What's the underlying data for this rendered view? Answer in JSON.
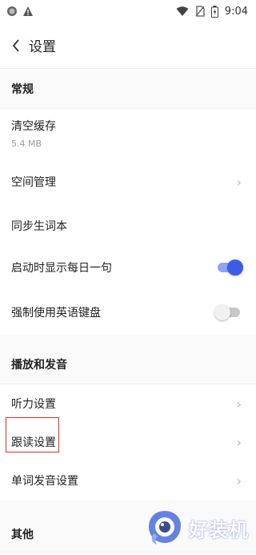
{
  "status_bar": {
    "time": "9:04"
  },
  "header": {
    "title": "设置"
  },
  "sections": {
    "general": {
      "title": "常规",
      "clear_cache": {
        "label": "清空缓存",
        "size": "5.4 MB"
      },
      "space_management": {
        "label": "空间管理"
      },
      "sync_wordbook": {
        "label": "同步生词本"
      },
      "daily_sentence": {
        "label": "启动时显示每日一句",
        "enabled": true
      },
      "force_english_keyboard": {
        "label": "强制使用英语键盘",
        "enabled": false
      }
    },
    "playback": {
      "title": "播放和发音",
      "listening": {
        "label": "听力设置"
      },
      "follow_reading": {
        "label": "跟读设置"
      },
      "word_pronunciation": {
        "label": "单词发音设置"
      }
    },
    "other": {
      "title": "其他"
    }
  },
  "watermark": {
    "text": "好装机"
  },
  "colors": {
    "accent": "#3d5ce6",
    "highlight": "#d9302c"
  }
}
